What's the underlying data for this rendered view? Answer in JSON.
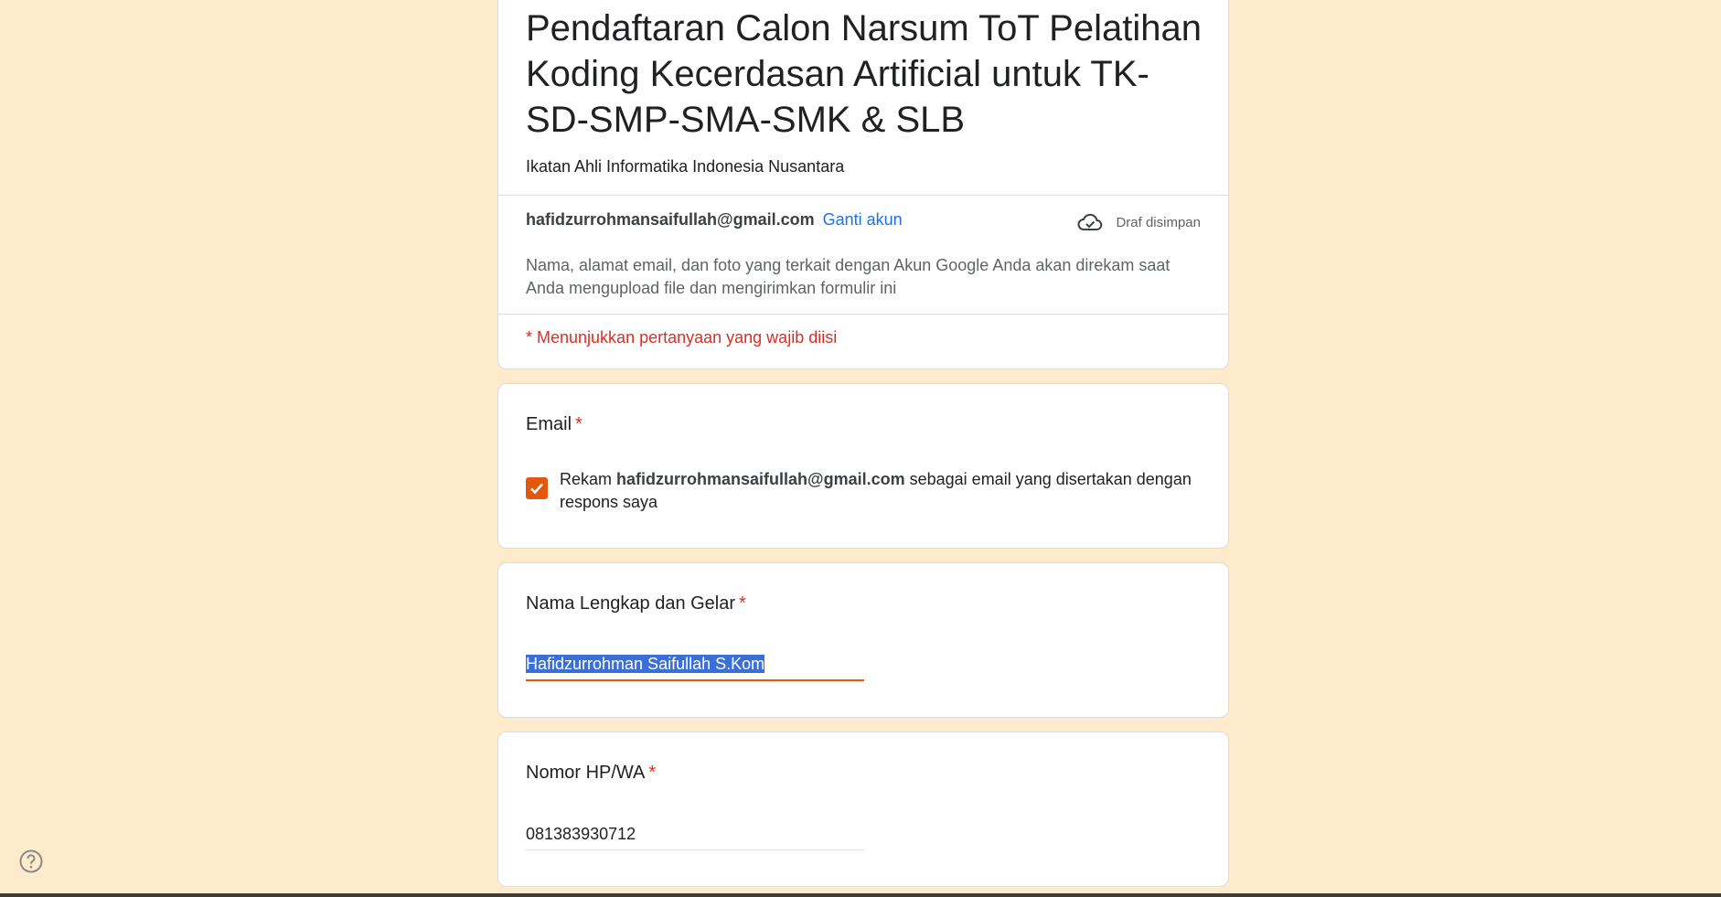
{
  "header": {
    "title": "Pendaftaran Calon Narsum ToT Pelatihan Koding Kecerdasan Artificial untuk TK-SD-SMP-SMA-SMK & SLB",
    "subtitle": "Ikatan Ahli Informatika Indonesia Nusantara",
    "account_email": "hafidzurrohmansaifullah@gmail.com",
    "switch_account_label": "Ganti akun",
    "draft_status": "Draf disimpan",
    "privacy_note": "Nama, alamat email, dan foto yang terkait dengan Akun Google Anda akan direkam saat Anda mengupload file dan mengirimkan formulir ini",
    "required_note": "* Menunjukkan pertanyaan yang wajib diisi"
  },
  "questions": {
    "email": {
      "title": "Email",
      "required_mark": "*",
      "checkbox_checked": true,
      "label_prefix": "Rekam ",
      "label_email": "hafidzurrohmansaifullah@gmail.com",
      "label_suffix": " sebagai email yang disertakan dengan respons saya"
    },
    "name": {
      "title": "Nama Lengkap dan Gelar",
      "required_mark": "*",
      "value": "Hafidzurrohman Saifullah S.Kom"
    },
    "phone": {
      "title": "Nomor HP/WA",
      "required_mark": "*",
      "value": "081383930712"
    }
  },
  "colors": {
    "background": "#fdebcc",
    "accent": "#e0590f",
    "required": "#d93025",
    "link": "#1a73e8"
  },
  "icons": {
    "draft": "cloud-check-icon",
    "checkbox": "check-icon",
    "help": "help-circle-icon"
  }
}
